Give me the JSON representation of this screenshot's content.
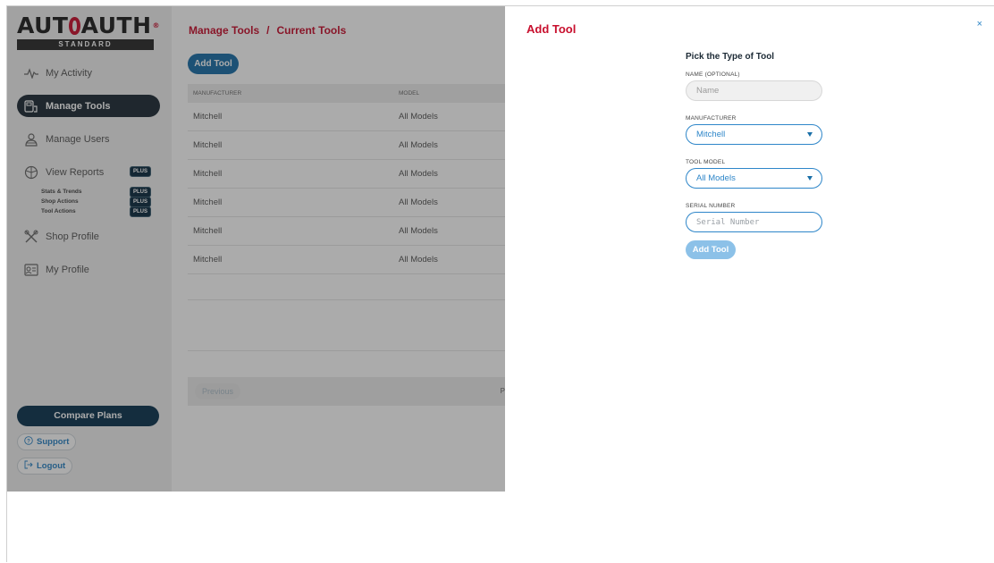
{
  "logo": {
    "name_left": "AUT",
    "name_mid": "AUTH",
    "sub": "STANDARD"
  },
  "sidebar": {
    "items": [
      {
        "label": "My Activity",
        "icon": "activity-icon"
      },
      {
        "label": "Manage Tools",
        "icon": "tools-icon",
        "active": true
      },
      {
        "label": "Manage Users",
        "icon": "users-icon"
      },
      {
        "label": "View Reports",
        "icon": "reports-icon",
        "badge": "PLUS"
      },
      {
        "label": "Shop Profile",
        "icon": "wrench-icon"
      },
      {
        "label": "My Profile",
        "icon": "id-card-icon"
      }
    ],
    "sub_items": [
      {
        "label": "Stats & Trends",
        "badge": "PLUS"
      },
      {
        "label": "Shop Actions",
        "badge": "PLUS"
      },
      {
        "label": "Tool Actions",
        "badge": "PLUS"
      }
    ],
    "compare_label": "Compare Plans",
    "support_label": "Support",
    "logout_label": "Logout"
  },
  "main": {
    "breadcrumb": [
      "Manage Tools",
      "Current Tools"
    ],
    "breadcrumb_sep": "/",
    "add_tool_label": "Add Tool",
    "columns": [
      "MANUFACTURER",
      "MODEL"
    ],
    "rows": [
      [
        "Mitchell",
        "All Models"
      ],
      [
        "Mitchell",
        "All Models"
      ],
      [
        "Mitchell",
        "All Models"
      ],
      [
        "Mitchell",
        "All Models"
      ],
      [
        "Mitchell",
        "All Models"
      ],
      [
        "Mitchell",
        "All Models"
      ]
    ],
    "previous_label": "Previous",
    "page_label": "P"
  },
  "panel": {
    "title": "Add Tool",
    "close": "×",
    "heading": "Pick the Type of Tool",
    "name_label": "NAME (OPTIONAL)",
    "name_placeholder": "Name",
    "manufacturer_label": "MANUFACTURER",
    "manufacturer_value": "Mitchell",
    "model_label": "TOOL MODEL",
    "model_value": "All Models",
    "serial_label": "SERIAL NUMBER",
    "serial_placeholder": "Serial Number",
    "submit_label": "Add Tool"
  },
  "colors": {
    "accent_red": "#c8102e",
    "brand_blue": "#1a6fa8",
    "navy": "#0c3550"
  }
}
